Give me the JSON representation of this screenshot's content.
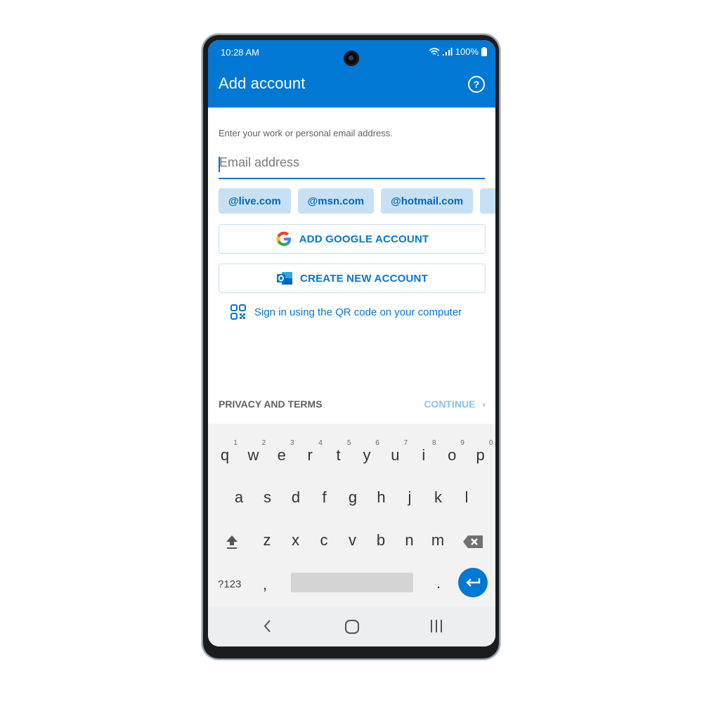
{
  "status_bar": {
    "time": "10:28 AM",
    "battery": "100%"
  },
  "app_bar": {
    "title": "Add account",
    "help_icon": "help-circle-icon"
  },
  "form": {
    "prompt": "Enter your work or personal email address.",
    "email_value": "",
    "email_placeholder": "Email address",
    "domain_chips": [
      "@live.com",
      "@msn.com",
      "@hotmail.com"
    ]
  },
  "buttons": {
    "google": "ADD GOOGLE ACCOUNT",
    "create": "CREATE NEW ACCOUNT",
    "qr": "Sign in using the QR code on your computer"
  },
  "footer": {
    "privacy": "PRIVACY AND TERMS",
    "continue": "CONTINUE"
  },
  "keyboard": {
    "row1": [
      "q",
      "w",
      "e",
      "r",
      "t",
      "y",
      "u",
      "i",
      "o",
      "p"
    ],
    "row1_hints": [
      "1",
      "2",
      "3",
      "4",
      "5",
      "6",
      "7",
      "8",
      "9",
      "0"
    ],
    "row2": [
      "a",
      "s",
      "d",
      "f",
      "g",
      "h",
      "j",
      "k",
      "l"
    ],
    "row3": [
      "z",
      "x",
      "c",
      "v",
      "b",
      "n",
      "m"
    ],
    "symbols": "?123",
    "comma": ",",
    "period": "."
  },
  "colors": {
    "accent": "#0078d4",
    "chip_bg": "#c7e0f4",
    "continue_disabled": "#8cc3ec"
  }
}
